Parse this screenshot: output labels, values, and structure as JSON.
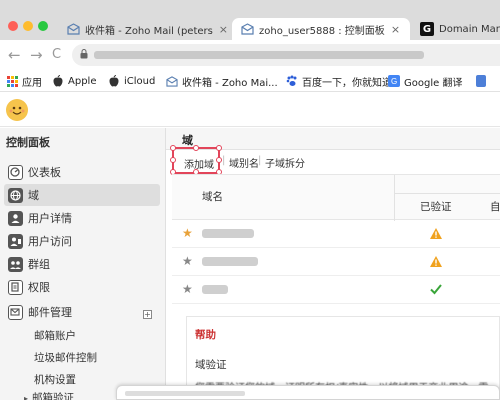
{
  "browser": {
    "tabs": [
      {
        "label": "收件箱 - Zoho Mail (peterson_",
        "close": "×",
        "icon": "zoho-mail-icon"
      },
      {
        "label": "zoho_user5888 : 控制面板",
        "close": "×",
        "icon": "zoho-mail-icon"
      },
      {
        "label": "Domain Manag",
        "icon": "g-logo-icon"
      }
    ],
    "nav": {
      "back": "←",
      "forward": "→",
      "reload": "C"
    },
    "bookmarks": [
      {
        "label": "应用",
        "icon": "apps-grid-icon"
      },
      {
        "label": "Apple",
        "icon": "apple-icon"
      },
      {
        "label": "iCloud",
        "icon": "apple-icon"
      },
      {
        "label": "收件箱 - Zoho Mai...",
        "icon": "zoho-mail-icon"
      },
      {
        "label": "百度一下，你就知道",
        "icon": "baidu-paw-icon"
      },
      {
        "label": "Google 翻译",
        "icon": "google-translate-icon"
      }
    ],
    "traffic_light_colors": [
      "#fe5f57",
      "#febc2e",
      "#28c840"
    ]
  },
  "sidebar": {
    "title": "控制面板",
    "items": [
      {
        "label": "仪表板",
        "icon": "dashboard-icon"
      },
      {
        "label": "域",
        "icon": "globe-icon"
      },
      {
        "label": "用户详情",
        "icon": "user-icon"
      },
      {
        "label": "用户访问",
        "icon": "user-access-icon"
      },
      {
        "label": "群组",
        "icon": "group-icon"
      },
      {
        "label": "权限",
        "icon": "permission-icon"
      },
      {
        "label": "邮件管理",
        "icon": "mail-icon"
      }
    ],
    "expand_symbol": "+",
    "subitems": [
      "邮箱账户",
      "垃圾邮件控制",
      "机构设置",
      "邮箱验证"
    ],
    "subitem_arrow": "▸"
  },
  "main": {
    "title": "域",
    "toolbar": {
      "add_domain": "添加域",
      "domain_alias": "域别名",
      "subdomain_split": "子域拆分",
      "separator": "|"
    },
    "columns": {
      "domain": "域名",
      "verified": "已验证",
      "next": "自"
    },
    "rows": [
      {
        "star": "★",
        "status": "warning",
        "star_color": "#e8a23a"
      },
      {
        "star": "★",
        "status": "warning",
        "star_color": "#888888"
      },
      {
        "star": "★",
        "status": "verified",
        "star_color": "#888888"
      }
    ],
    "help": {
      "title": "帮助",
      "subtitle": "域验证",
      "text": "您需要验证您的域，证明所有权/真实性，以将域用于商业用途。需"
    }
  },
  "colors": {
    "highlight": "#e2455a",
    "warning": "#f0a21e",
    "success": "#3aa53a",
    "help_title": "#cc3333"
  }
}
